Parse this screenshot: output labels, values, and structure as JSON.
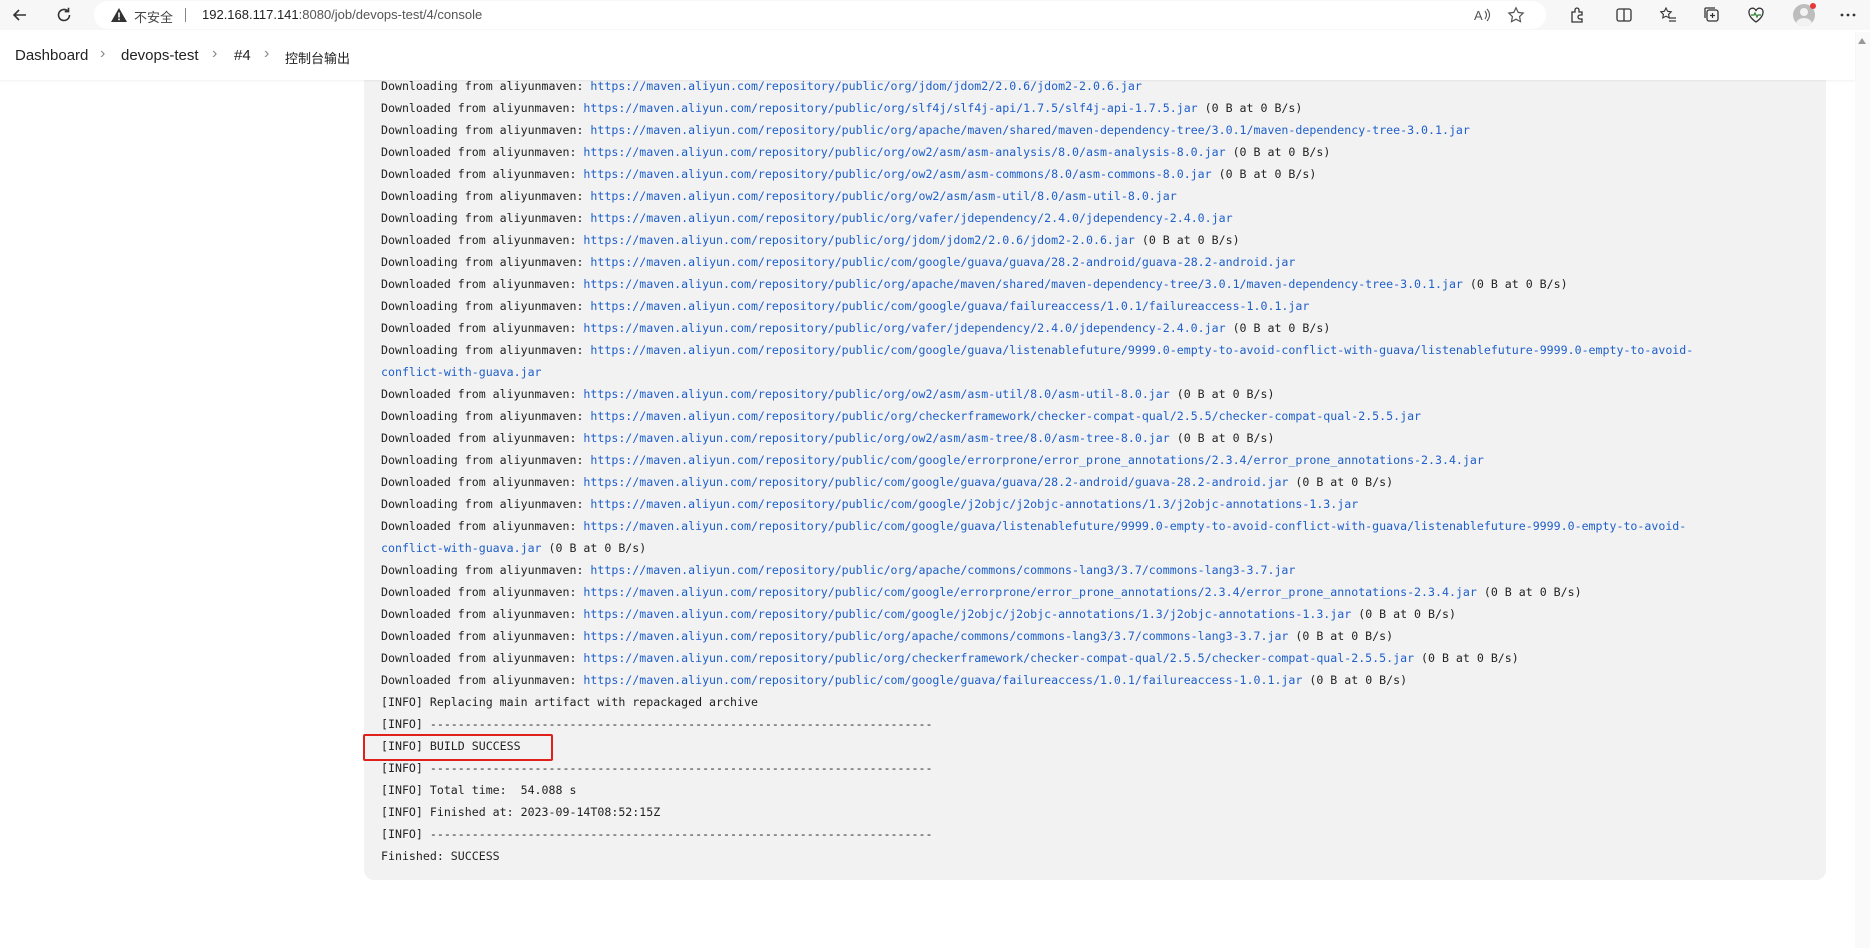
{
  "browser": {
    "insecure_label": "不安全",
    "url_host": "192.168.117.141",
    "url_rest": ":8080/job/devops-test/4/console"
  },
  "breadcrumb": {
    "dashboard": "Dashboard",
    "job": "devops-test",
    "build": "#4",
    "page": "控制台输出"
  },
  "console": {
    "lines": [
      {
        "prefix": "Downloading from aliyunmaven: ",
        "url": "https://maven.aliyun.com/repository/public/org/jdom/jdom2/2.0.6/jdom2-2.0.6.jar",
        "suffix": ""
      },
      {
        "prefix": "Downloaded from aliyunmaven: ",
        "url": "https://maven.aliyun.com/repository/public/org/slf4j/slf4j-api/1.7.5/slf4j-api-1.7.5.jar",
        "suffix": " (0 B at 0 B/s)"
      },
      {
        "prefix": "Downloading from aliyunmaven: ",
        "url": "https://maven.aliyun.com/repository/public/org/apache/maven/shared/maven-dependency-tree/3.0.1/maven-dependency-tree-3.0.1.jar",
        "suffix": ""
      },
      {
        "prefix": "Downloaded from aliyunmaven: ",
        "url": "https://maven.aliyun.com/repository/public/org/ow2/asm/asm-analysis/8.0/asm-analysis-8.0.jar",
        "suffix": " (0 B at 0 B/s)"
      },
      {
        "prefix": "Downloaded from aliyunmaven: ",
        "url": "https://maven.aliyun.com/repository/public/org/ow2/asm/asm-commons/8.0/asm-commons-8.0.jar",
        "suffix": " (0 B at 0 B/s)"
      },
      {
        "prefix": "Downloading from aliyunmaven: ",
        "url": "https://maven.aliyun.com/repository/public/org/ow2/asm/asm-util/8.0/asm-util-8.0.jar",
        "suffix": ""
      },
      {
        "prefix": "Downloading from aliyunmaven: ",
        "url": "https://maven.aliyun.com/repository/public/org/vafer/jdependency/2.4.0/jdependency-2.4.0.jar",
        "suffix": ""
      },
      {
        "prefix": "Downloaded from aliyunmaven: ",
        "url": "https://maven.aliyun.com/repository/public/org/jdom/jdom2/2.0.6/jdom2-2.0.6.jar",
        "suffix": " (0 B at 0 B/s)"
      },
      {
        "prefix": "Downloading from aliyunmaven: ",
        "url": "https://maven.aliyun.com/repository/public/com/google/guava/guava/28.2-android/guava-28.2-android.jar",
        "suffix": ""
      },
      {
        "prefix": "Downloaded from aliyunmaven: ",
        "url": "https://maven.aliyun.com/repository/public/org/apache/maven/shared/maven-dependency-tree/3.0.1/maven-dependency-tree-3.0.1.jar",
        "suffix": " (0 B at 0 B/s)"
      },
      {
        "prefix": "Downloading from aliyunmaven: ",
        "url": "https://maven.aliyun.com/repository/public/com/google/guava/failureaccess/1.0.1/failureaccess-1.0.1.jar",
        "suffix": ""
      },
      {
        "prefix": "Downloaded from aliyunmaven: ",
        "url": "https://maven.aliyun.com/repository/public/org/vafer/jdependency/2.4.0/jdependency-2.4.0.jar",
        "suffix": " (0 B at 0 B/s)"
      },
      {
        "prefix": "Downloading from aliyunmaven: ",
        "url": "https://maven.aliyun.com/repository/public/com/google/guava/listenablefuture/9999.0-empty-to-avoid-conflict-with-guava/listenablefuture-9999.0-empty-to-avoid-",
        "suffix": ""
      },
      {
        "prefix": "",
        "url": "conflict-with-guava.jar",
        "suffix": ""
      },
      {
        "prefix": "Downloaded from aliyunmaven: ",
        "url": "https://maven.aliyun.com/repository/public/org/ow2/asm/asm-util/8.0/asm-util-8.0.jar",
        "suffix": " (0 B at 0 B/s)"
      },
      {
        "prefix": "Downloading from aliyunmaven: ",
        "url": "https://maven.aliyun.com/repository/public/org/checkerframework/checker-compat-qual/2.5.5/checker-compat-qual-2.5.5.jar",
        "suffix": ""
      },
      {
        "prefix": "Downloaded from aliyunmaven: ",
        "url": "https://maven.aliyun.com/repository/public/org/ow2/asm/asm-tree/8.0/asm-tree-8.0.jar",
        "suffix": " (0 B at 0 B/s)"
      },
      {
        "prefix": "Downloading from aliyunmaven: ",
        "url": "https://maven.aliyun.com/repository/public/com/google/errorprone/error_prone_annotations/2.3.4/error_prone_annotations-2.3.4.jar",
        "suffix": ""
      },
      {
        "prefix": "Downloaded from aliyunmaven: ",
        "url": "https://maven.aliyun.com/repository/public/com/google/guava/guava/28.2-android/guava-28.2-android.jar",
        "suffix": " (0 B at 0 B/s)"
      },
      {
        "prefix": "Downloading from aliyunmaven: ",
        "url": "https://maven.aliyun.com/repository/public/com/google/j2objc/j2objc-annotations/1.3/j2objc-annotations-1.3.jar",
        "suffix": ""
      },
      {
        "prefix": "Downloaded from aliyunmaven: ",
        "url": "https://maven.aliyun.com/repository/public/com/google/guava/listenablefuture/9999.0-empty-to-avoid-conflict-with-guava/listenablefuture-9999.0-empty-to-avoid-",
        "suffix": ""
      },
      {
        "prefix": "",
        "url": "conflict-with-guava.jar",
        "suffix": " (0 B at 0 B/s)"
      },
      {
        "prefix": "Downloading from aliyunmaven: ",
        "url": "https://maven.aliyun.com/repository/public/org/apache/commons/commons-lang3/3.7/commons-lang3-3.7.jar",
        "suffix": ""
      },
      {
        "prefix": "Downloaded from aliyunmaven: ",
        "url": "https://maven.aliyun.com/repository/public/com/google/errorprone/error_prone_annotations/2.3.4/error_prone_annotations-2.3.4.jar",
        "suffix": " (0 B at 0 B/s)"
      },
      {
        "prefix": "Downloaded from aliyunmaven: ",
        "url": "https://maven.aliyun.com/repository/public/com/google/j2objc/j2objc-annotations/1.3/j2objc-annotations-1.3.jar",
        "suffix": " (0 B at 0 B/s)"
      },
      {
        "prefix": "Downloaded from aliyunmaven: ",
        "url": "https://maven.aliyun.com/repository/public/org/apache/commons/commons-lang3/3.7/commons-lang3-3.7.jar",
        "suffix": " (0 B at 0 B/s)"
      },
      {
        "prefix": "Downloaded from aliyunmaven: ",
        "url": "https://maven.aliyun.com/repository/public/org/checkerframework/checker-compat-qual/2.5.5/checker-compat-qual-2.5.5.jar",
        "suffix": " (0 B at 0 B/s)"
      },
      {
        "prefix": "Downloaded from aliyunmaven: ",
        "url": "https://maven.aliyun.com/repository/public/com/google/guava/failureaccess/1.0.1/failureaccess-1.0.1.jar",
        "suffix": " (0 B at 0 B/s)"
      },
      {
        "prefix": "[INFO] Replacing main artifact with repackaged archive",
        "url": "",
        "suffix": ""
      },
      {
        "prefix": "[INFO] ------------------------------------------------------------------------",
        "url": "",
        "suffix": ""
      },
      {
        "prefix": "[INFO] BUILD SUCCESS",
        "url": "",
        "suffix": ""
      },
      {
        "prefix": "[INFO] ------------------------------------------------------------------------",
        "url": "",
        "suffix": ""
      },
      {
        "prefix": "[INFO] Total time:  54.088 s",
        "url": "",
        "suffix": ""
      },
      {
        "prefix": "[INFO] Finished at: 2023-09-14T08:52:15Z",
        "url": "",
        "suffix": ""
      },
      {
        "prefix": "[INFO] ------------------------------------------------------------------------",
        "url": "",
        "suffix": ""
      },
      {
        "prefix": "Finished: SUCCESS",
        "url": "",
        "suffix": ""
      }
    ]
  },
  "colors": {
    "link": "#1f5fc9",
    "highlight_border": "#e0201b",
    "console_bg": "#f2f2f3"
  }
}
